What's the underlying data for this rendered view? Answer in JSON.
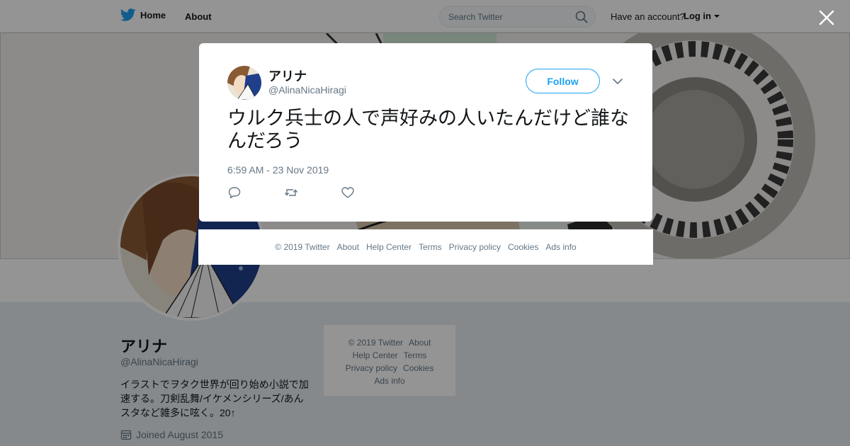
{
  "topbar": {
    "home_label": "Home",
    "about_label": "About",
    "search_placeholder": "Search Twitter",
    "have_account": "Have an account?",
    "login_label": "Log in"
  },
  "profile": {
    "name": "アリナ",
    "handle": "@AlinaNicaHiragi",
    "bio": "イラストでヲタク世界が回り始め小説で加速する。刀剣乱舞/イケメンシリーズ/あんスタなど雑多に呟く。20↑",
    "joined": "Joined August 2015"
  },
  "side_footer": {
    "copyright": "© 2019 Twitter",
    "about": "About",
    "help": "Help Center",
    "terms": "Terms",
    "privacy": "Privacy policy",
    "cookies": "Cookies",
    "ads": "Ads info"
  },
  "tweet": {
    "name": "アリナ",
    "handle": "@AlinaNicaHiragi",
    "follow_label": "Follow",
    "text": "ウルク兵士の人で声好みの人いたんだけど誰なんだろう",
    "timestamp": "6:59 AM - 23 Nov 2019"
  },
  "overlay_footer": {
    "copyright": "© 2019 Twitter",
    "about": "About",
    "help": "Help Center",
    "terms": "Terms",
    "privacy": "Privacy policy",
    "cookies": "Cookies",
    "ads": "Ads info"
  },
  "icons": {
    "bird": "twitter-bird-icon",
    "search": "search-icon",
    "close": "close-icon",
    "chevron": "chevron-down-icon",
    "reply": "reply-icon",
    "retweet": "retweet-icon",
    "like": "heart-icon",
    "calendar": "calendar-icon"
  },
  "colors": {
    "accent": "#1da1f2",
    "text": "#14171a",
    "secondary": "#657786",
    "overlay": "rgba(0,0,0,0.42)"
  }
}
